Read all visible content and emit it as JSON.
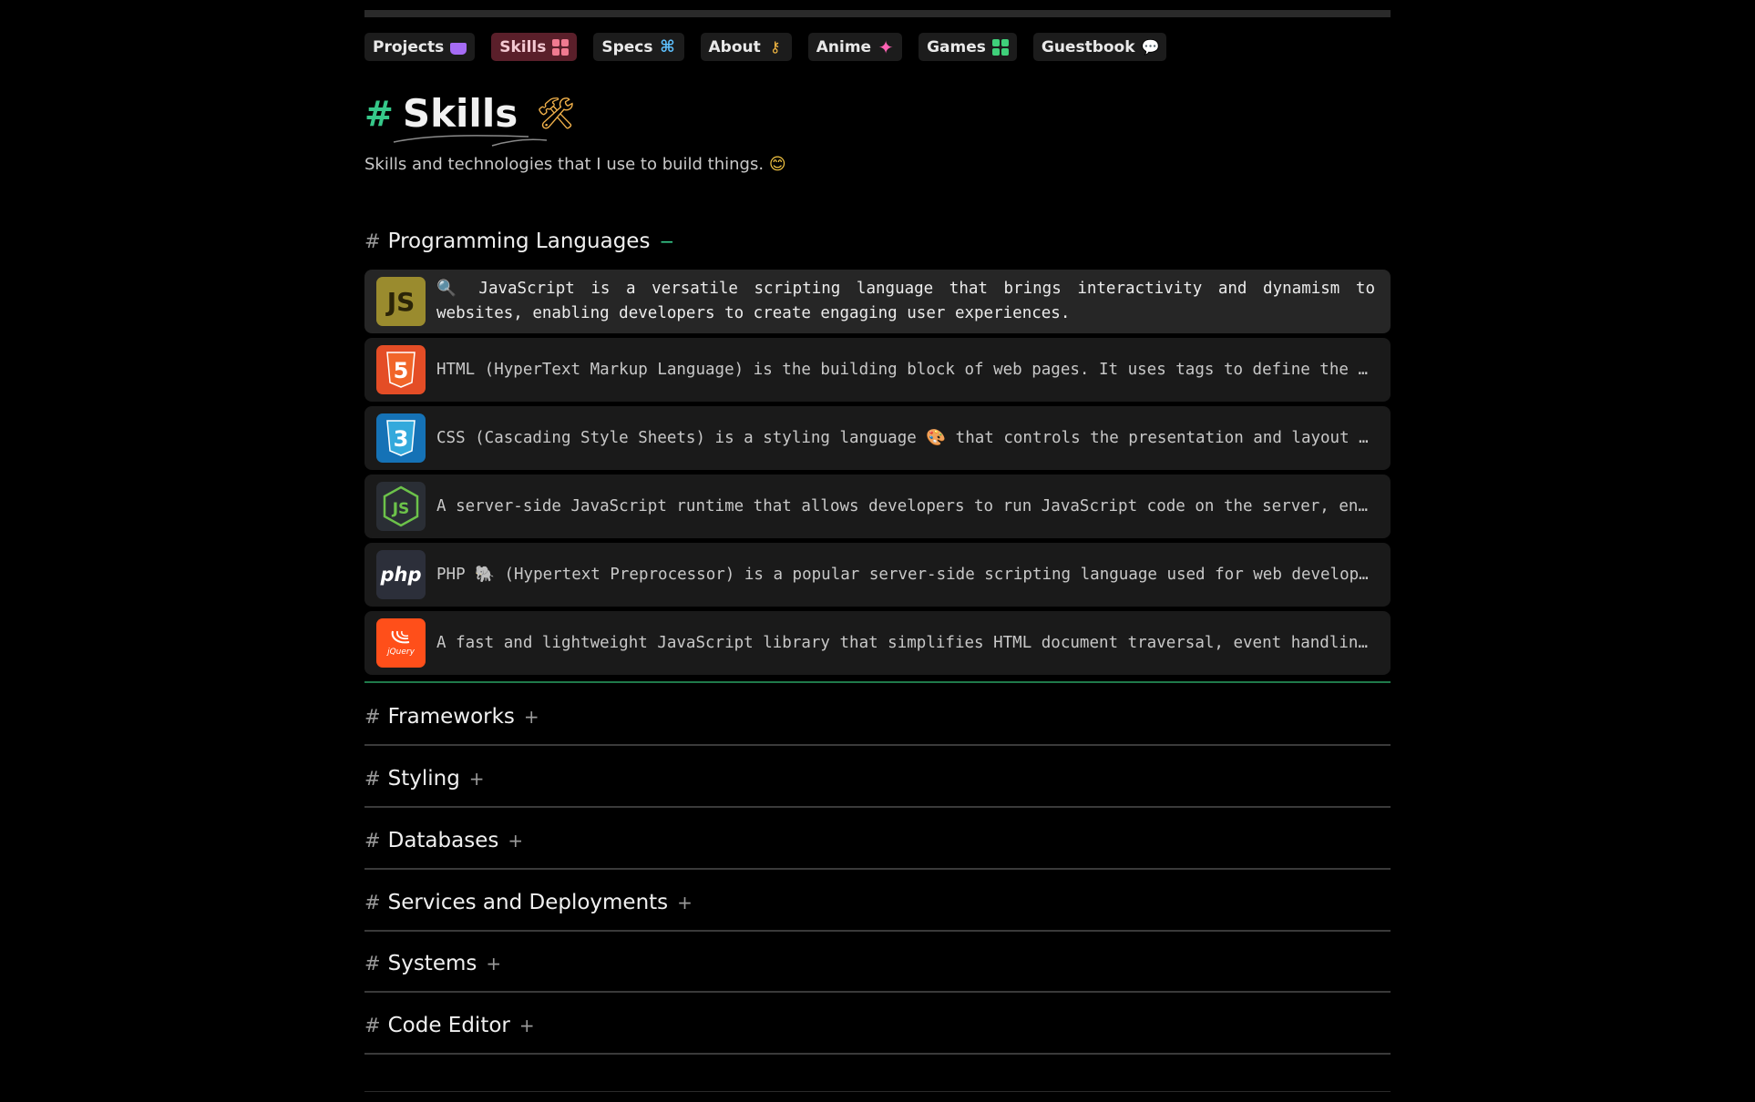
{
  "nav": [
    {
      "label": "Projects",
      "icon": "basket-icon",
      "active": false
    },
    {
      "label": "Skills",
      "icon": "grid-icon",
      "active": true
    },
    {
      "label": "Specs",
      "icon": "command-icon",
      "active": false
    },
    {
      "label": "About",
      "icon": "key-icon",
      "active": false
    },
    {
      "label": "Anime",
      "icon": "sparkle-icon",
      "active": false
    },
    {
      "label": "Games",
      "icon": "grid-icon",
      "active": false
    },
    {
      "label": "Guestbook",
      "icon": "chat-icon",
      "active": false
    }
  ],
  "page": {
    "hash": "#",
    "title": "Skills",
    "title_emoji": "🛠",
    "subtitle": "Skills and technologies that I use to build things.",
    "subtitle_emoji": "😊"
  },
  "sections": [
    {
      "hash": "#",
      "title": "Programming Languages",
      "toggle": "−",
      "open": true
    },
    {
      "hash": "#",
      "title": "Frameworks",
      "toggle": "+",
      "open": false
    },
    {
      "hash": "#",
      "title": "Styling",
      "toggle": "+",
      "open": false
    },
    {
      "hash": "#",
      "title": "Databases",
      "toggle": "+",
      "open": false
    },
    {
      "hash": "#",
      "title": "Services and Deployments",
      "toggle": "+",
      "open": false
    },
    {
      "hash": "#",
      "title": "Systems",
      "toggle": "+",
      "open": false
    },
    {
      "hash": "#",
      "title": "Code Editor",
      "toggle": "+",
      "open": false
    }
  ],
  "skills": [
    {
      "logo": "JS",
      "icon": "javascript-icon",
      "text": "🔍  JavaScript is a versatile scripting language that brings interactivity and dynamism to websites, enabling developers to create engaging user experiences."
    },
    {
      "logo": "5",
      "icon": "html5-icon",
      "text": "HTML (HyperText Markup Language) is the building block of web pages. It uses tags to define the structure a..."
    },
    {
      "logo": "3",
      "icon": "css3-icon",
      "text": "CSS (Cascading Style Sheets) is a styling language 🎨 that controls the presentation and layout of HTML document..."
    },
    {
      "logo": "JS",
      "icon": "nodejs-icon",
      "text": "A server-side JavaScript runtime that allows developers to run JavaScript code on the server, enabling the creati..."
    },
    {
      "logo": "php",
      "icon": "php-icon",
      "text": "PHP 🐘 (Hypertext Preprocessor) is a popular server-side scripting language used for web development, especial..."
    },
    {
      "logo": "jQuery",
      "icon": "jquery-icon",
      "text": "A fast and lightweight JavaScript library that simplifies HTML document traversal, event handling, animating, a..."
    }
  ],
  "colors": {
    "accent_green": "#36c88a",
    "active_nav_bg": "#5a1f2a",
    "javascript": "#9a8b2e",
    "html": "#e44d26",
    "css": "#1572b6",
    "nodejs": "#2a2e35",
    "php": "#2c2f3a",
    "jquery": "#ff4f1a"
  }
}
